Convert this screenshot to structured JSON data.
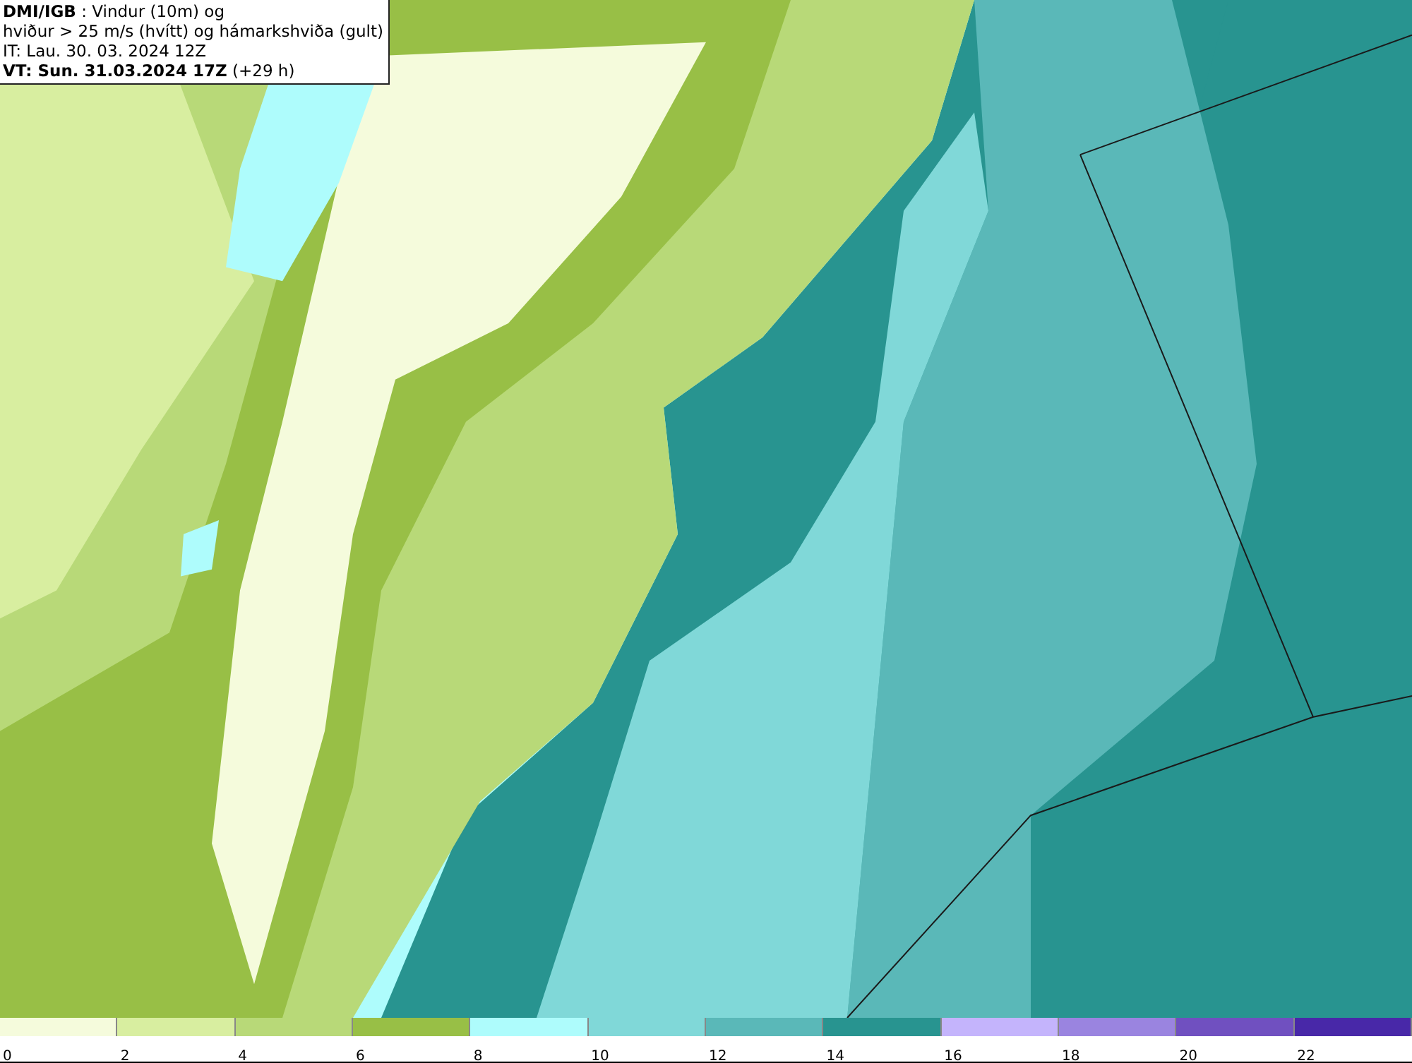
{
  "header": {
    "lines": [
      "**DMI/IGB** : Vindur (10m) og",
      "hviður > 25 m/s (hvítt) og hámarkshviða (gult)",
      "IT: Lau. 30. 03. 2024 12Z",
      "**VT: Sun. 31.03.2024 17Z** (+29 h)"
    ]
  },
  "legend": {
    "items": [
      {
        "color": "#f5fbdc",
        "label": "0"
      },
      {
        "color": "#d8eea0",
        "label": "2"
      },
      {
        "color": "#b8d978",
        "label": "4"
      },
      {
        "color": "#98bf46",
        "label": "6"
      },
      {
        "color": "#aefcfc",
        "label": "8"
      },
      {
        "color": "#80d8d8",
        "label": "10"
      },
      {
        "color": "#5ab8b8",
        "label": "12"
      },
      {
        "color": "#289490",
        "label": "14"
      },
      {
        "color": "#c4b4fc",
        "label": "16"
      },
      {
        "color": "#9a84e0",
        "label": "18"
      },
      {
        "color": "#7050c0",
        "label": "20"
      },
      {
        "color": "#4828a8",
        "label": "22"
      }
    ]
  }
}
